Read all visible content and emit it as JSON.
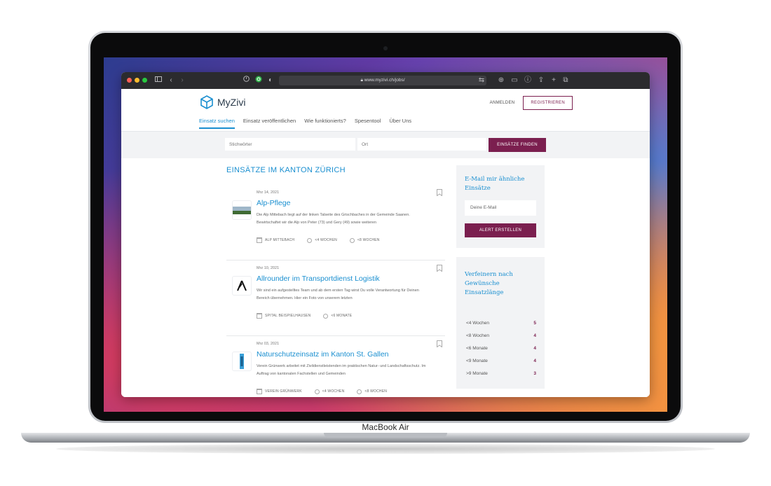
{
  "device_label": "MacBook Air",
  "browser": {
    "url": "www.myzivi.ch/jobs/",
    "toolbar_icons": [
      "sidebar-icon",
      "back-icon",
      "forward-icon",
      "shield-icon",
      "extension-icon",
      "privacy-icon",
      "translate-icon",
      "download-icon",
      "reader-icon",
      "info-icon",
      "share-icon",
      "new-tab-icon",
      "tabs-icon"
    ]
  },
  "header": {
    "logo_text": "MyZivi",
    "login_label": "ANMELDEN",
    "register_label": "REGISTRIEREN",
    "tabs": [
      {
        "label": "Einsatz suchen",
        "active": true
      },
      {
        "label": "Einsatz veröffentlichen",
        "active": false
      },
      {
        "label": "Wie funktionierts?",
        "active": false
      },
      {
        "label": "Spesentool",
        "active": false
      },
      {
        "label": "Über Uns",
        "active": false
      }
    ]
  },
  "search": {
    "keywords_placeholder": "Stichwörter",
    "location_placeholder": "Ort",
    "button_label": "EINSÄTZE FINDEN"
  },
  "main": {
    "title": "EINSÄTZE IM KANTON ZÜRICH",
    "jobs": [
      {
        "date": "Mrz 14, 2021",
        "title": "Alp-Pflege",
        "description": "Die Alp Mittebach liegt auf der linken Talseite des Grischbaches in der Gemeinde Saanen. Bewirtschaftet wir die Alp von Peter (73) und  Gery (49) sowie weiteren",
        "organization": "ALP MITTEBACH",
        "min_duration": "<4 WOCHEN",
        "max_duration": "<8 WOCHEN"
      },
      {
        "date": "Mrz 10, 2021",
        "title": "Allrounder im Transportdienst Logistik",
        "description": "Wir sind ein aufgestelltes Team und ab dem ersten Tag wirst Du volle Verantwortung für Deinen Bereich übernehmen. Hier ein Foto von unserem letzten",
        "organization": "SPITAL BEISPIELHAUSEN",
        "min_duration": "<6 MONATE",
        "max_duration": ""
      },
      {
        "date": "Mrz 03, 2021",
        "title": "Naturschutzeinsatz im Kanton St. Gallen",
        "description": "Verein Grünwerk arbeitet mit Zivildienstleistenden im praktischen Natur- und Landschaftsschutz. Im Auftrag von kantonalen Fachstellen und Gemeinden",
        "organization": "VEREIN GRÜNWERK",
        "min_duration": "<4 WOCHEN",
        "max_duration": "<8 WOCHEN"
      }
    ]
  },
  "sidebar": {
    "alert": {
      "title_line1": "E-Mail mir ähnliche",
      "title_line2": "Einsätze",
      "email_placeholder": "Deine E-Mail",
      "button_label": "ALERT ERSTELLEN"
    },
    "refine": {
      "title_line1": "Verfeinern nach",
      "title_line2": "Gewünsche",
      "title_line3": "Einsatzlänge",
      "filters": [
        {
          "label": "<4 Wochen",
          "count": "5"
        },
        {
          "label": "<8 Wochen",
          "count": "4"
        },
        {
          "label": "<6 Monate",
          "count": "4"
        },
        {
          "label": "<9 Monate",
          "count": "4"
        },
        {
          "label": ">9 Monate",
          "count": "3"
        }
      ]
    }
  },
  "colors": {
    "accent_blue": "#1a8fd0",
    "brand_plum": "#7b1f4f"
  }
}
